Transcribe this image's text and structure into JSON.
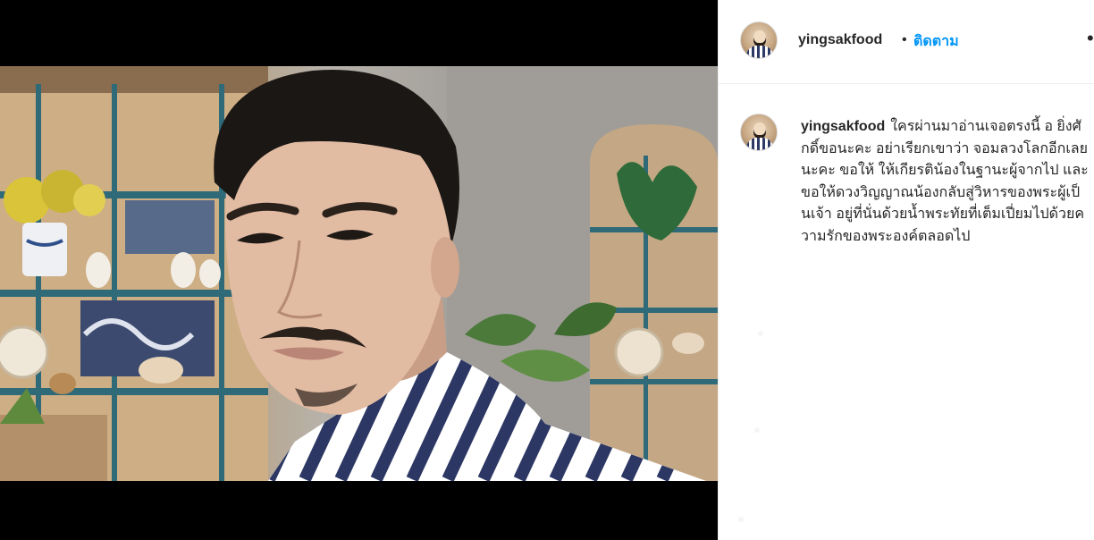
{
  "post": {
    "username": "yingsakfood",
    "follow_label": "ติดตาม",
    "separator": "•",
    "more_label": "•"
  },
  "caption": {
    "username": "yingsakfood",
    "text": "ใครผ่านมาอ่านเจอตรงนี้ อ ยิ่งศักดิ์ขอนะคะ อย่าเรียกเขาว่า จอมลวงโลกอีกเลยนะคะ ขอให้ ให้เกียรติน้องในฐานะผู้จากไป และขอให้ดวงวิญญาณน้องกลับสู่วิหารของพระผู้เป็นเจ้า อยู่ที่นั่นด้วยน้ำพระทัยที่เต็มเปี่ยมไปด้วยความรักของพระองค์ตลอดไป"
  },
  "icons": {
    "avatar": "profile-avatar-icon",
    "more": "more-options-icon"
  },
  "colors": {
    "follow": "#0095f6",
    "text": "#262626",
    "divider": "#efefef"
  }
}
